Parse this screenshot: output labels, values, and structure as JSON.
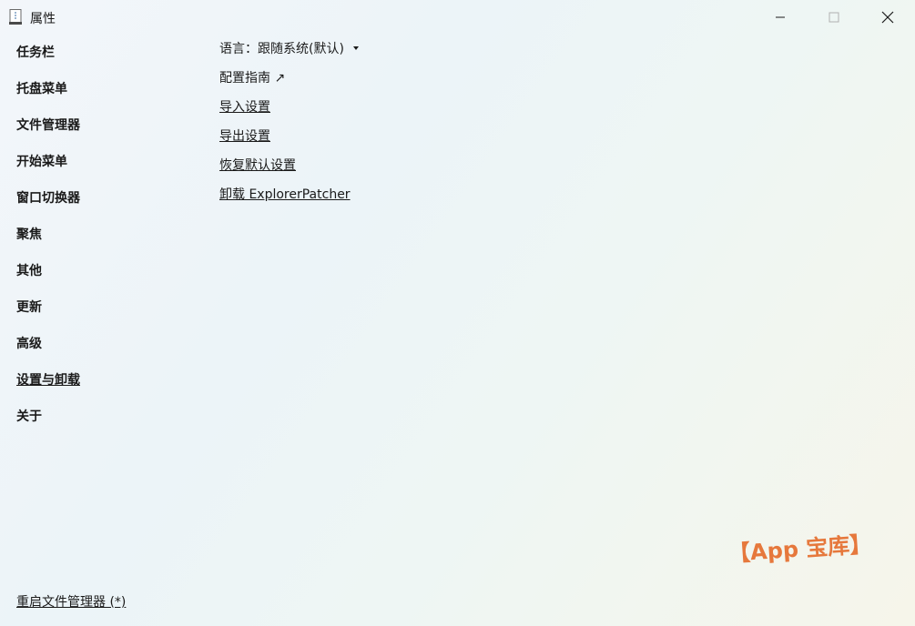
{
  "window": {
    "title": "属性"
  },
  "sidebar": {
    "items": [
      {
        "label": "任务栏"
      },
      {
        "label": "托盘菜单"
      },
      {
        "label": "文件管理器"
      },
      {
        "label": "开始菜单"
      },
      {
        "label": "窗口切换器"
      },
      {
        "label": "聚焦"
      },
      {
        "label": "其他"
      },
      {
        "label": "更新"
      },
      {
        "label": "高级"
      },
      {
        "label": "设置与卸载"
      },
      {
        "label": "关于"
      }
    ],
    "active_index": 9
  },
  "main": {
    "language_label": "语言：跟随系统(默认)",
    "guide_label": "配置指南 ↗",
    "import_label": "导入设置",
    "export_label": "导出设置",
    "restore_label": "恢复默认设置",
    "uninstall_label": "卸载 ExplorerPatcher"
  },
  "footer": {
    "restart_label": "重启文件管理器 (*)"
  },
  "watermark": {
    "text": "【App 宝库】",
    "color": "#e6783c"
  },
  "icons": {
    "app": "document-icon",
    "dropdown": "caret-down-icon",
    "minimize": "minimize-icon",
    "maximize": "maximize-icon",
    "close": "close-icon"
  }
}
